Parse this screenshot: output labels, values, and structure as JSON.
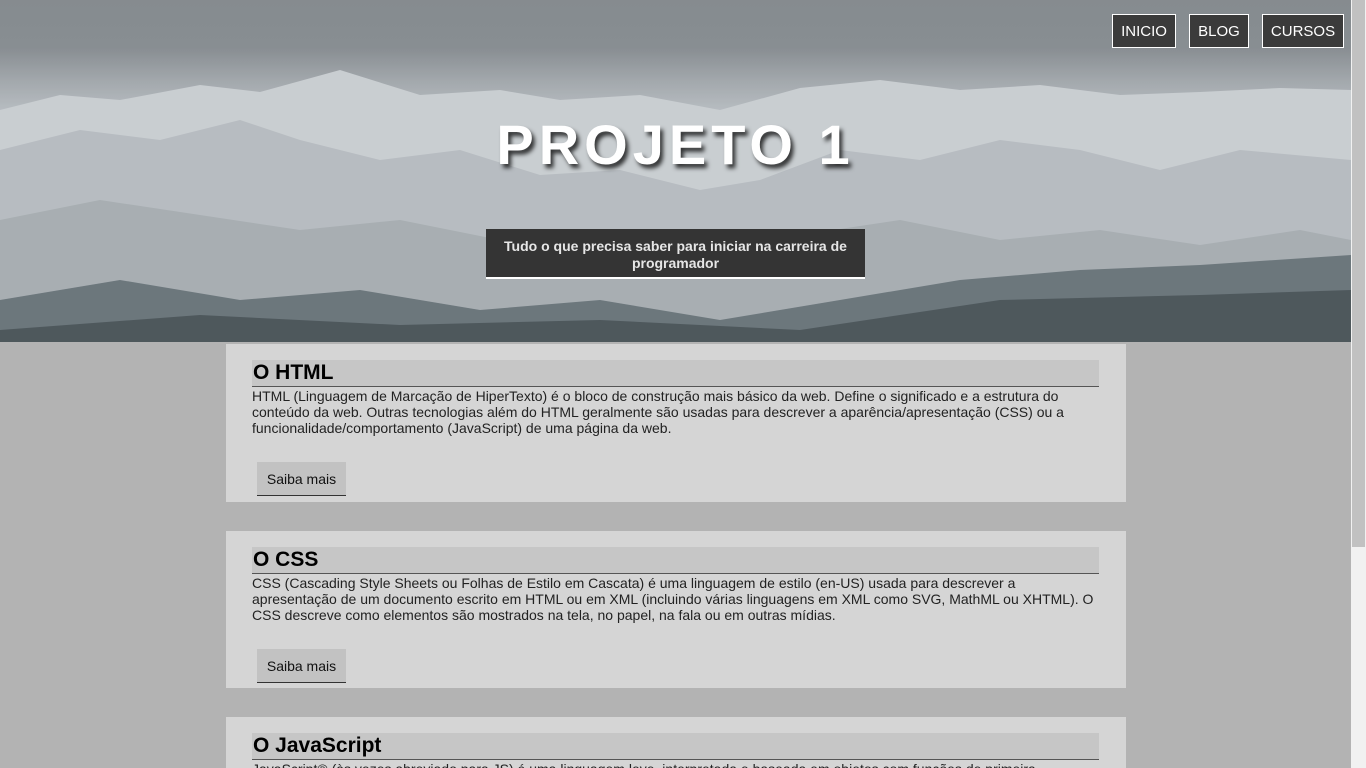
{
  "nav": {
    "items": [
      "INICIO",
      "BLOG",
      "CURSOS"
    ]
  },
  "hero": {
    "title": "PROJETO 1",
    "subtitle": "Tudo o que precisa saber para iniciar na carreira de programador"
  },
  "cards": [
    {
      "title": "O HTML",
      "text": "HTML (Linguagem de Marcação de HiperTexto) é o bloco de construção mais básico da web. Define o significado e a estrutura do conteúdo da web. Outras tecnologias além do HTML geralmente são usadas para descrever a aparência/apresentação (CSS) ou a funcionalidade/comportamento (JavaScript) de uma página da web.",
      "button": "Saiba mais"
    },
    {
      "title": "O CSS",
      "text": "CSS (Cascading Style Sheets ou Folhas de Estilo em Cascata) é uma linguagem de estilo (en-US) usada para descrever a apresentação de um documento escrito em HTML ou em XML (incluindo várias linguagens em XML como SVG, MathML ou XHTML). O CSS descreve como elementos são mostrados na tela, no papel, na fala ou em outras mídias.",
      "button": "Saiba mais"
    },
    {
      "title": "O JavaScript",
      "text": "JavaScript® (às vezes abreviado para JS) é uma linguagem leve, interpretada e baseada em objetos com funções de primeira"
    }
  ]
}
